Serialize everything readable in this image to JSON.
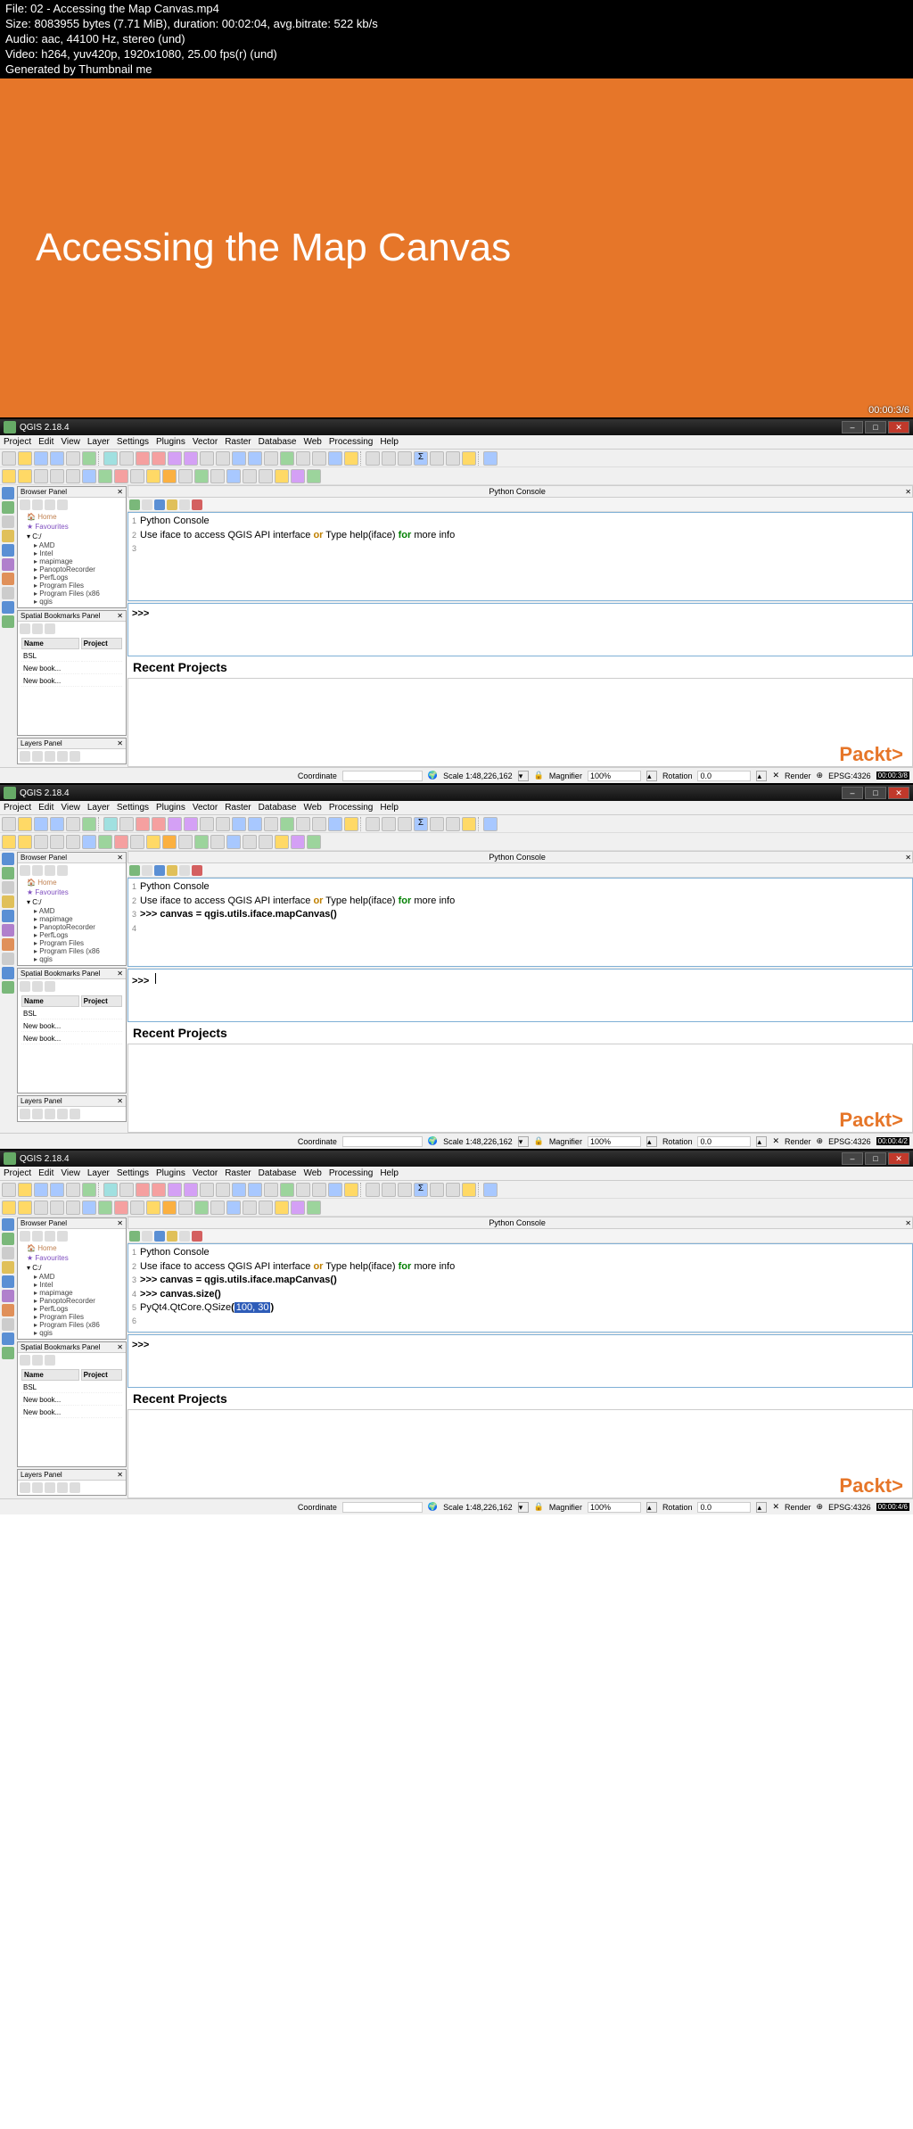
{
  "meta": {
    "file": "File: 02 - Accessing the Map Canvas.mp4",
    "size": "Size: 8083955 bytes (7.71 MiB), duration: 00:02:04, avg.bitrate: 522 kb/s",
    "audio": "Audio: aac, 44100 Hz, stereo (und)",
    "video": "Video: h264, yuv420p, 1920x1080, 25.00 fps(r) (und)",
    "gen": "Generated by Thumbnail me"
  },
  "slide": {
    "title": "Accessing the Map Canvas",
    "time": "00:00:3/6"
  },
  "qgis": {
    "title": "QGIS 2.18.4"
  },
  "menu": [
    "Project",
    "Edit",
    "View",
    "Layer",
    "Settings",
    "Plugins",
    "Vector",
    "Raster",
    "Database",
    "Web",
    "Processing",
    "Help"
  ],
  "panels": {
    "browser": "Browser Panel",
    "bookmarks": "Spatial Bookmarks Panel",
    "layers": "Layers Panel",
    "python": "Python Console"
  },
  "tree": {
    "home": "Home",
    "fav": "Favourites",
    "c": "C:/",
    "items": [
      "AMD",
      "Intel",
      "mapimage",
      "PanoptoRecorder",
      "PerfLogs",
      "Program Files",
      "Program Files (x86",
      "qgis"
    ]
  },
  "bm": {
    "name": "Name",
    "project": "Project",
    "bsl": "BSL",
    "nb1": "New book...",
    "nb2": "New book..."
  },
  "console": {
    "l1": "Python Console",
    "l2a": "Use iface to access QGIS API interface ",
    "l2or": "or",
    "l2b": " Type help(iface) ",
    "l2for": "for",
    "l2c": " more info",
    "l3": ">>> canvas = qgis.utils.iface.mapCanvas",
    "l3p": "()",
    "l4": ">>> canvas.size",
    "l4p": "()",
    "l5a": "PyQt4.QtCore.QSize",
    "l5p1": "(",
    "l5h": "100, 30",
    "l5p2": ")",
    "prompt": ">>>"
  },
  "recent": "Recent Projects",
  "status": {
    "coord": "Coordinate",
    "scale": "Scale 1:48,226,162",
    "mag": "Magnifier",
    "magval": "100%",
    "rot": "Rotation",
    "rotval": "0.0",
    "render": "Render",
    "epsg": "EPSG:4326",
    "time1": "00:00:3/8",
    "time2": "00:00:4/2",
    "time3": "00:00:4/6"
  },
  "packt": "Packt",
  "brkt": ">"
}
